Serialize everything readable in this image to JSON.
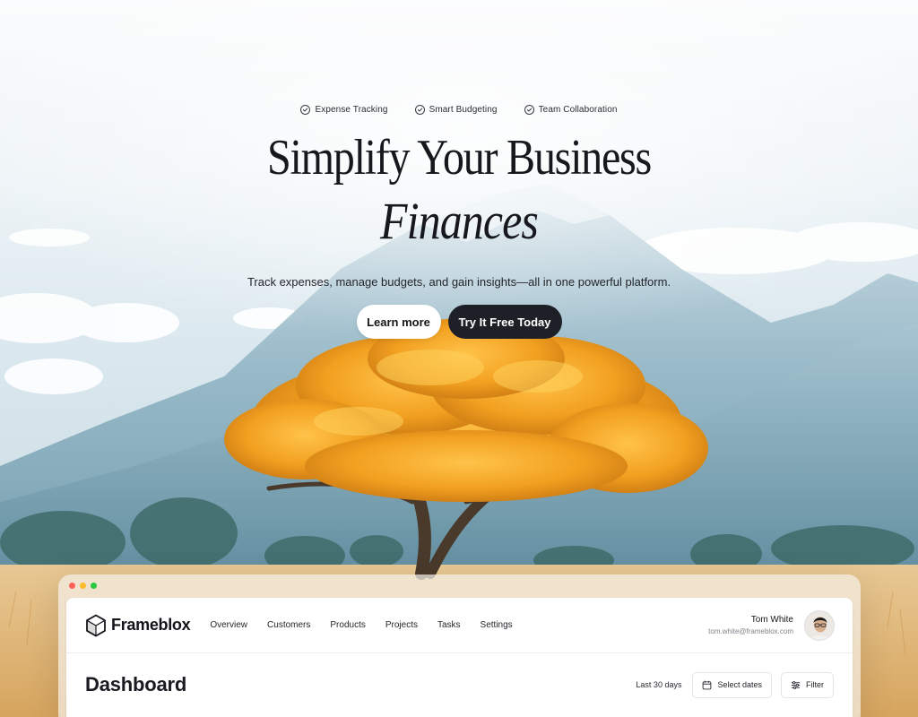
{
  "hero": {
    "features": [
      {
        "label": "Expense Tracking",
        "icon": "check-circle-icon"
      },
      {
        "label": "Smart Budgeting",
        "icon": "check-circle-icon"
      },
      {
        "label": "Team Collaboration",
        "icon": "check-circle-icon"
      }
    ],
    "headline_line1": "Simplify Your Business",
    "headline_line2": "Finances",
    "subtitle": "Track expenses, manage budgets, and gain insights—all in one powerful platform.",
    "cta_secondary": "Learn more",
    "cta_primary": "Try It Free Today"
  },
  "window": {
    "dot_colors": [
      "#ff5f57",
      "#febc2e",
      "#28c840"
    ]
  },
  "app": {
    "brand": "Frameblox",
    "nav": [
      "Overview",
      "Customers",
      "Products",
      "Projects",
      "Tasks",
      "Settings"
    ],
    "user": {
      "name": "Tom White",
      "email": "tom.white@frameblox.com"
    },
    "page_title": "Dashboard",
    "date_range_label": "Last 30 days",
    "select_dates_label": "Select dates",
    "filter_label": "Filter"
  },
  "colors": {
    "primary_button": "#1e2027",
    "tree_accent": "#f0a21a"
  }
}
